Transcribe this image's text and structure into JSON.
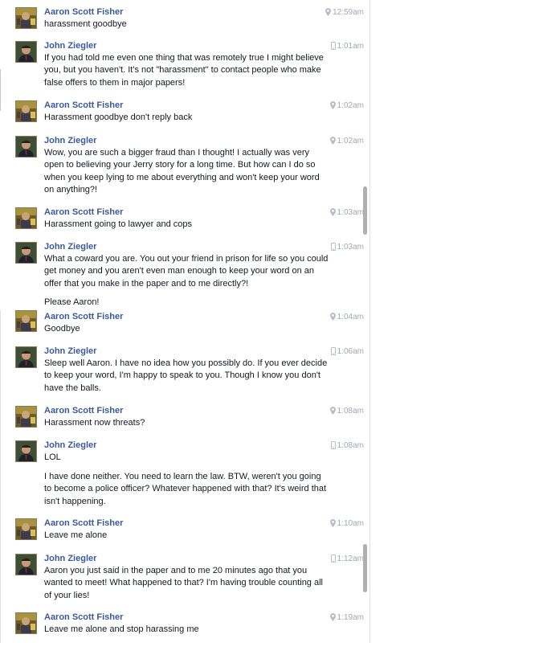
{
  "colors": {
    "name": "#3b5998",
    "text": "#141823",
    "meta": "#a0a6b3",
    "border": "#dddfe2"
  },
  "icons": {
    "map_pin": "map-pin-icon",
    "mobile": "mobile-phone-icon"
  },
  "people": {
    "aaron": "Aaron Scott Fisher",
    "john": "John Ziegler"
  },
  "panel_a": {
    "messages": [
      {
        "sender": "Aaron Scott Fisher",
        "avatar": "aaron",
        "device": "map-pin",
        "time": "12:59am",
        "paragraphs": [
          "harassment goodbye"
        ]
      },
      {
        "sender": "John Ziegler",
        "avatar": "john",
        "device": "mobile",
        "time": "1:01am",
        "paragraphs": [
          "If you had told me even one thing that was remotely true I might believe you, but you haven't. It's not \"harassment\" to contact people who make false offers to them in major papers!"
        ]
      },
      {
        "sender": "Aaron Scott Fisher",
        "avatar": "aaron",
        "device": "map-pin",
        "time": "1:02am",
        "paragraphs": [
          "Harassment goodbye don't reply back"
        ]
      },
      {
        "sender": "John Ziegler",
        "avatar": "john",
        "device": "map-pin",
        "time": "1:02am",
        "paragraphs": [
          "Wow, you are such a bigger fraud than I thought! I actually was very open to believing your Jerry story for a long time. But how can I do so when you keep lying to me about everything and won't keep your word on anything?!"
        ]
      },
      {
        "sender": "Aaron Scott Fisher",
        "avatar": "aaron",
        "device": "map-pin",
        "time": "1:03am",
        "paragraphs": [
          "Harassment going to lawyer and cops"
        ]
      },
      {
        "sender": "John Ziegler",
        "avatar": "john",
        "device": "mobile",
        "time": "1:03am",
        "paragraphs": [
          "What a coward you are. You out your friend in prison for life so you could get money and you aren't even man enough to keep your word on an offer that you make in the paper and to me directly?!",
          "Please Aaron!"
        ]
      }
    ]
  },
  "panel_b": {
    "messages": [
      {
        "sender": "Aaron Scott Fisher",
        "avatar": "aaron",
        "device": "map-pin",
        "time": "1:04am",
        "paragraphs": [
          "Goodbye"
        ]
      },
      {
        "sender": "John Ziegler",
        "avatar": "john",
        "device": "mobile",
        "time": "1:06am",
        "paragraphs": [
          "Sleep well Aaron. I have no idea how you possibly do. If you ever decide to keep your word, I'm happy to speak to you. Though I know you don't have the balls."
        ]
      },
      {
        "sender": "Aaron Scott Fisher",
        "avatar": "aaron",
        "device": "map-pin",
        "time": "1:08am",
        "paragraphs": [
          "Harassment now threats?"
        ]
      },
      {
        "sender": "John Ziegler",
        "avatar": "john",
        "device": "mobile",
        "time": "1:08am",
        "paragraphs": [
          "LOL",
          "I have done neither. You need to learn the law. BTW, weren't you going to become a police officer? Whatever happened with that? It's weird that isn't happening."
        ]
      },
      {
        "sender": "Aaron Scott Fisher",
        "avatar": "aaron",
        "device": "map-pin",
        "time": "1:10am",
        "paragraphs": [
          "Leave me alone"
        ]
      },
      {
        "sender": "John Ziegler",
        "avatar": "john",
        "device": "mobile",
        "time": "1:12am",
        "paragraphs": [
          "Aaron you just said in the paper and to me 20 minutes ago that you wanted to meet! What happened to that? I'm having trouble counting all of your lies!"
        ]
      },
      {
        "sender": "Aaron Scott Fisher",
        "avatar": "aaron",
        "device": "map-pin",
        "time": "1:19am",
        "paragraphs": [
          "Leave me alone and stop harassing me"
        ]
      }
    ]
  }
}
